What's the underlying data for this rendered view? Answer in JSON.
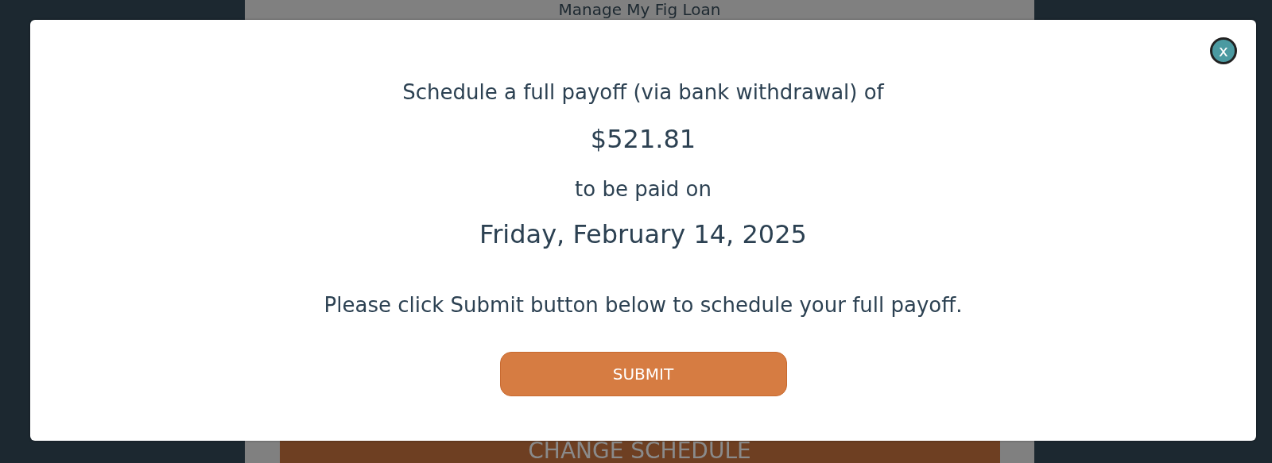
{
  "page": {
    "title": "Manage My Fig Loan",
    "button": "CHANGE SCHEDULE"
  },
  "modal": {
    "close": "x",
    "intro": "Schedule a full payoff (via bank withdrawal) of",
    "amount": "$521.81",
    "date_intro": "to be paid on",
    "date": "Friday, February 14, 2025",
    "instruction": "Please click Submit button below to schedule your full payoff.",
    "submit": "SUBMIT"
  }
}
